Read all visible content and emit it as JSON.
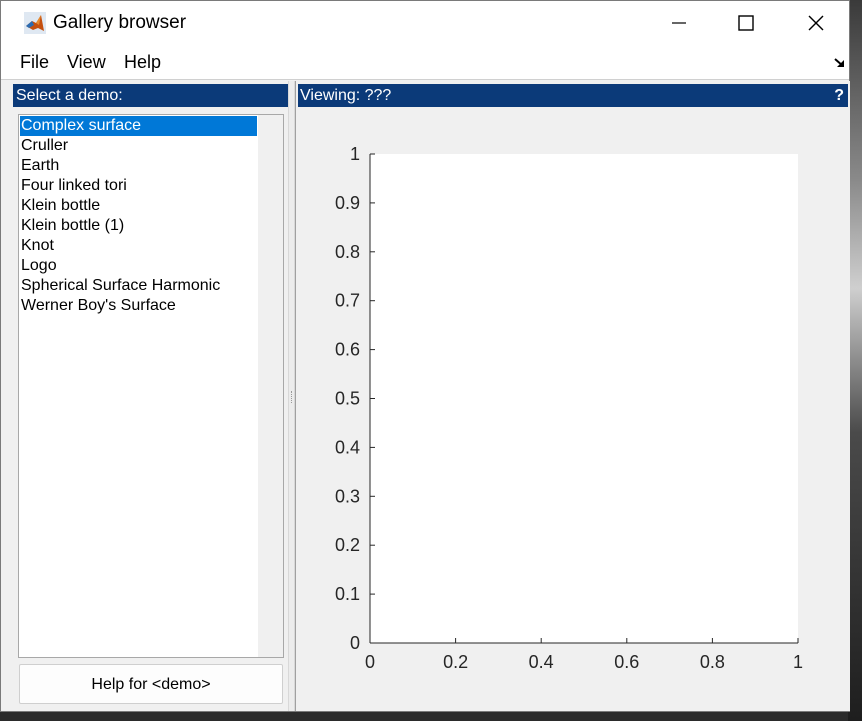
{
  "window": {
    "title": "Gallery browser"
  },
  "menu": {
    "items": [
      "File",
      "View",
      "Help"
    ]
  },
  "left_panel": {
    "header": "Select a demo:",
    "demos": [
      "Complex surface",
      "Cruller",
      "Earth",
      "Four linked tori",
      "Klein bottle",
      "Klein bottle (1)",
      "Knot",
      "Logo",
      "Spherical Surface Harmonic",
      "Werner Boy's Surface"
    ],
    "selected_index": 0,
    "help_button": "Help for <demo>"
  },
  "right_panel": {
    "header": "Viewing: ???",
    "help_glyph": "?"
  },
  "chart_data": {
    "type": "line",
    "title": "",
    "xlabel": "",
    "ylabel": "",
    "xlim": [
      0,
      1
    ],
    "ylim": [
      0,
      1
    ],
    "x_ticks": [
      "0",
      "0.2",
      "0.4",
      "0.6",
      "0.8",
      "1"
    ],
    "y_ticks": [
      "0",
      "0.1",
      "0.2",
      "0.3",
      "0.4",
      "0.5",
      "0.6",
      "0.7",
      "0.8",
      "0.9",
      "1"
    ],
    "series": [],
    "grid": false
  },
  "icons": {
    "app": "matlab-icon",
    "minimize": "minimize-icon",
    "maximize": "maximize-icon",
    "close": "close-icon",
    "dock": "dock-arrow-icon"
  }
}
